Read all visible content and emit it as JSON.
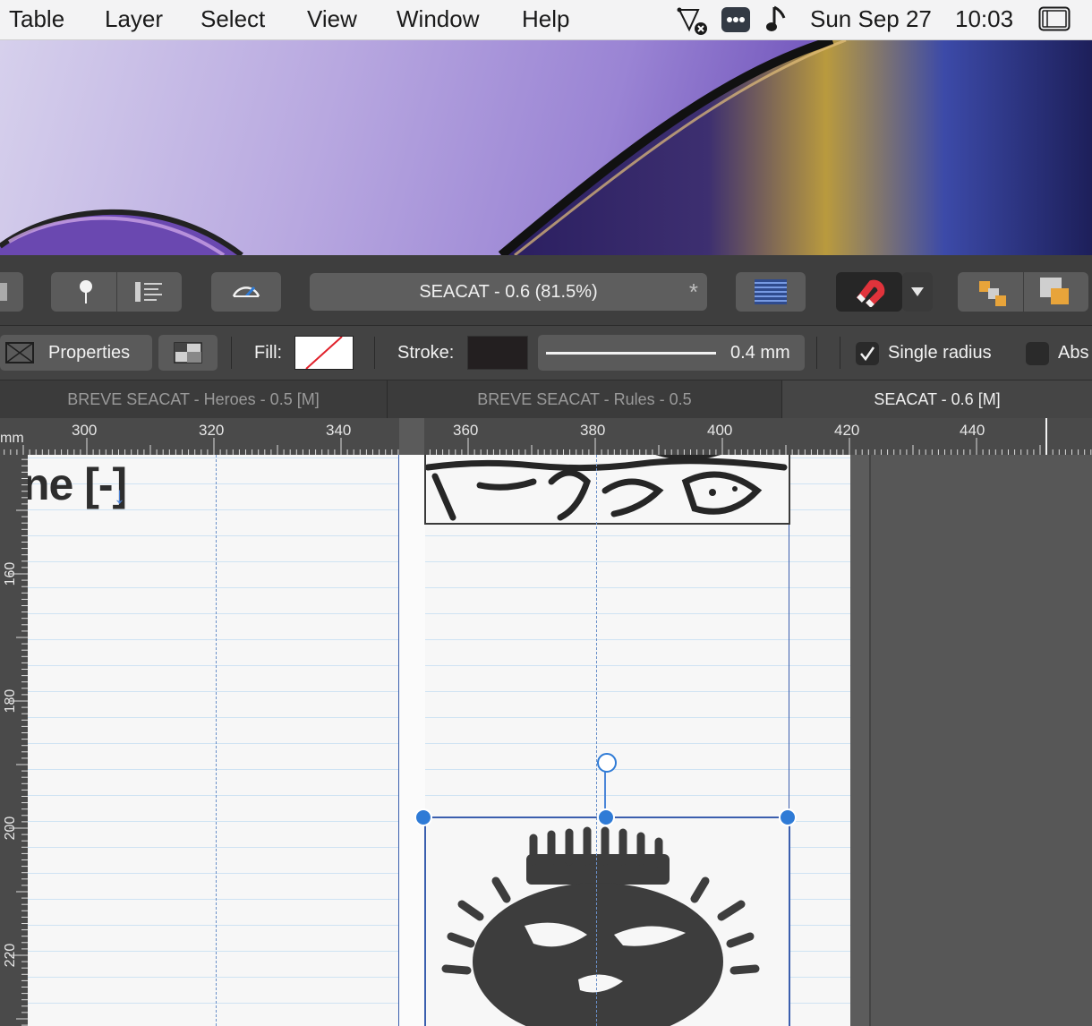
{
  "menubar": {
    "items": [
      "Table",
      "Layer",
      "Select",
      "View",
      "Window",
      "Help"
    ],
    "date": "Sun Sep 27",
    "time": "10:03"
  },
  "toolbar": {
    "document_title": "SEACAT - 0.6 (81.5%)",
    "modified_mark": "*"
  },
  "context": {
    "properties_label": "Properties",
    "fill_label": "Fill:",
    "stroke_label": "Stroke:",
    "stroke_width": "0.4 mm",
    "single_radius_label": "Single radius",
    "single_radius_checked": true,
    "abs_label": "Abs"
  },
  "tabs": [
    {
      "label": "BREVE SEACAT - Heroes - 0.5 [M]",
      "active": false
    },
    {
      "label": "BREVE SEACAT - Rules - 0.5",
      "active": false
    },
    {
      "label": "SEACAT - 0.6 [M]",
      "active": true
    }
  ],
  "ruler": {
    "unit": "mm",
    "top_ticks": [
      "300",
      "320",
      "340",
      "360",
      "380",
      "400",
      "420",
      "440"
    ],
    "left_ticks": [
      "160",
      "180",
      "200",
      "220"
    ]
  },
  "canvas": {
    "heading_fragment": "ne [-]"
  },
  "colors": {
    "accent": "#2f7bd6",
    "frame": "#3b5fae",
    "toolbar_bg": "#3e3e3e",
    "stroke_swatch": "#231f20"
  }
}
